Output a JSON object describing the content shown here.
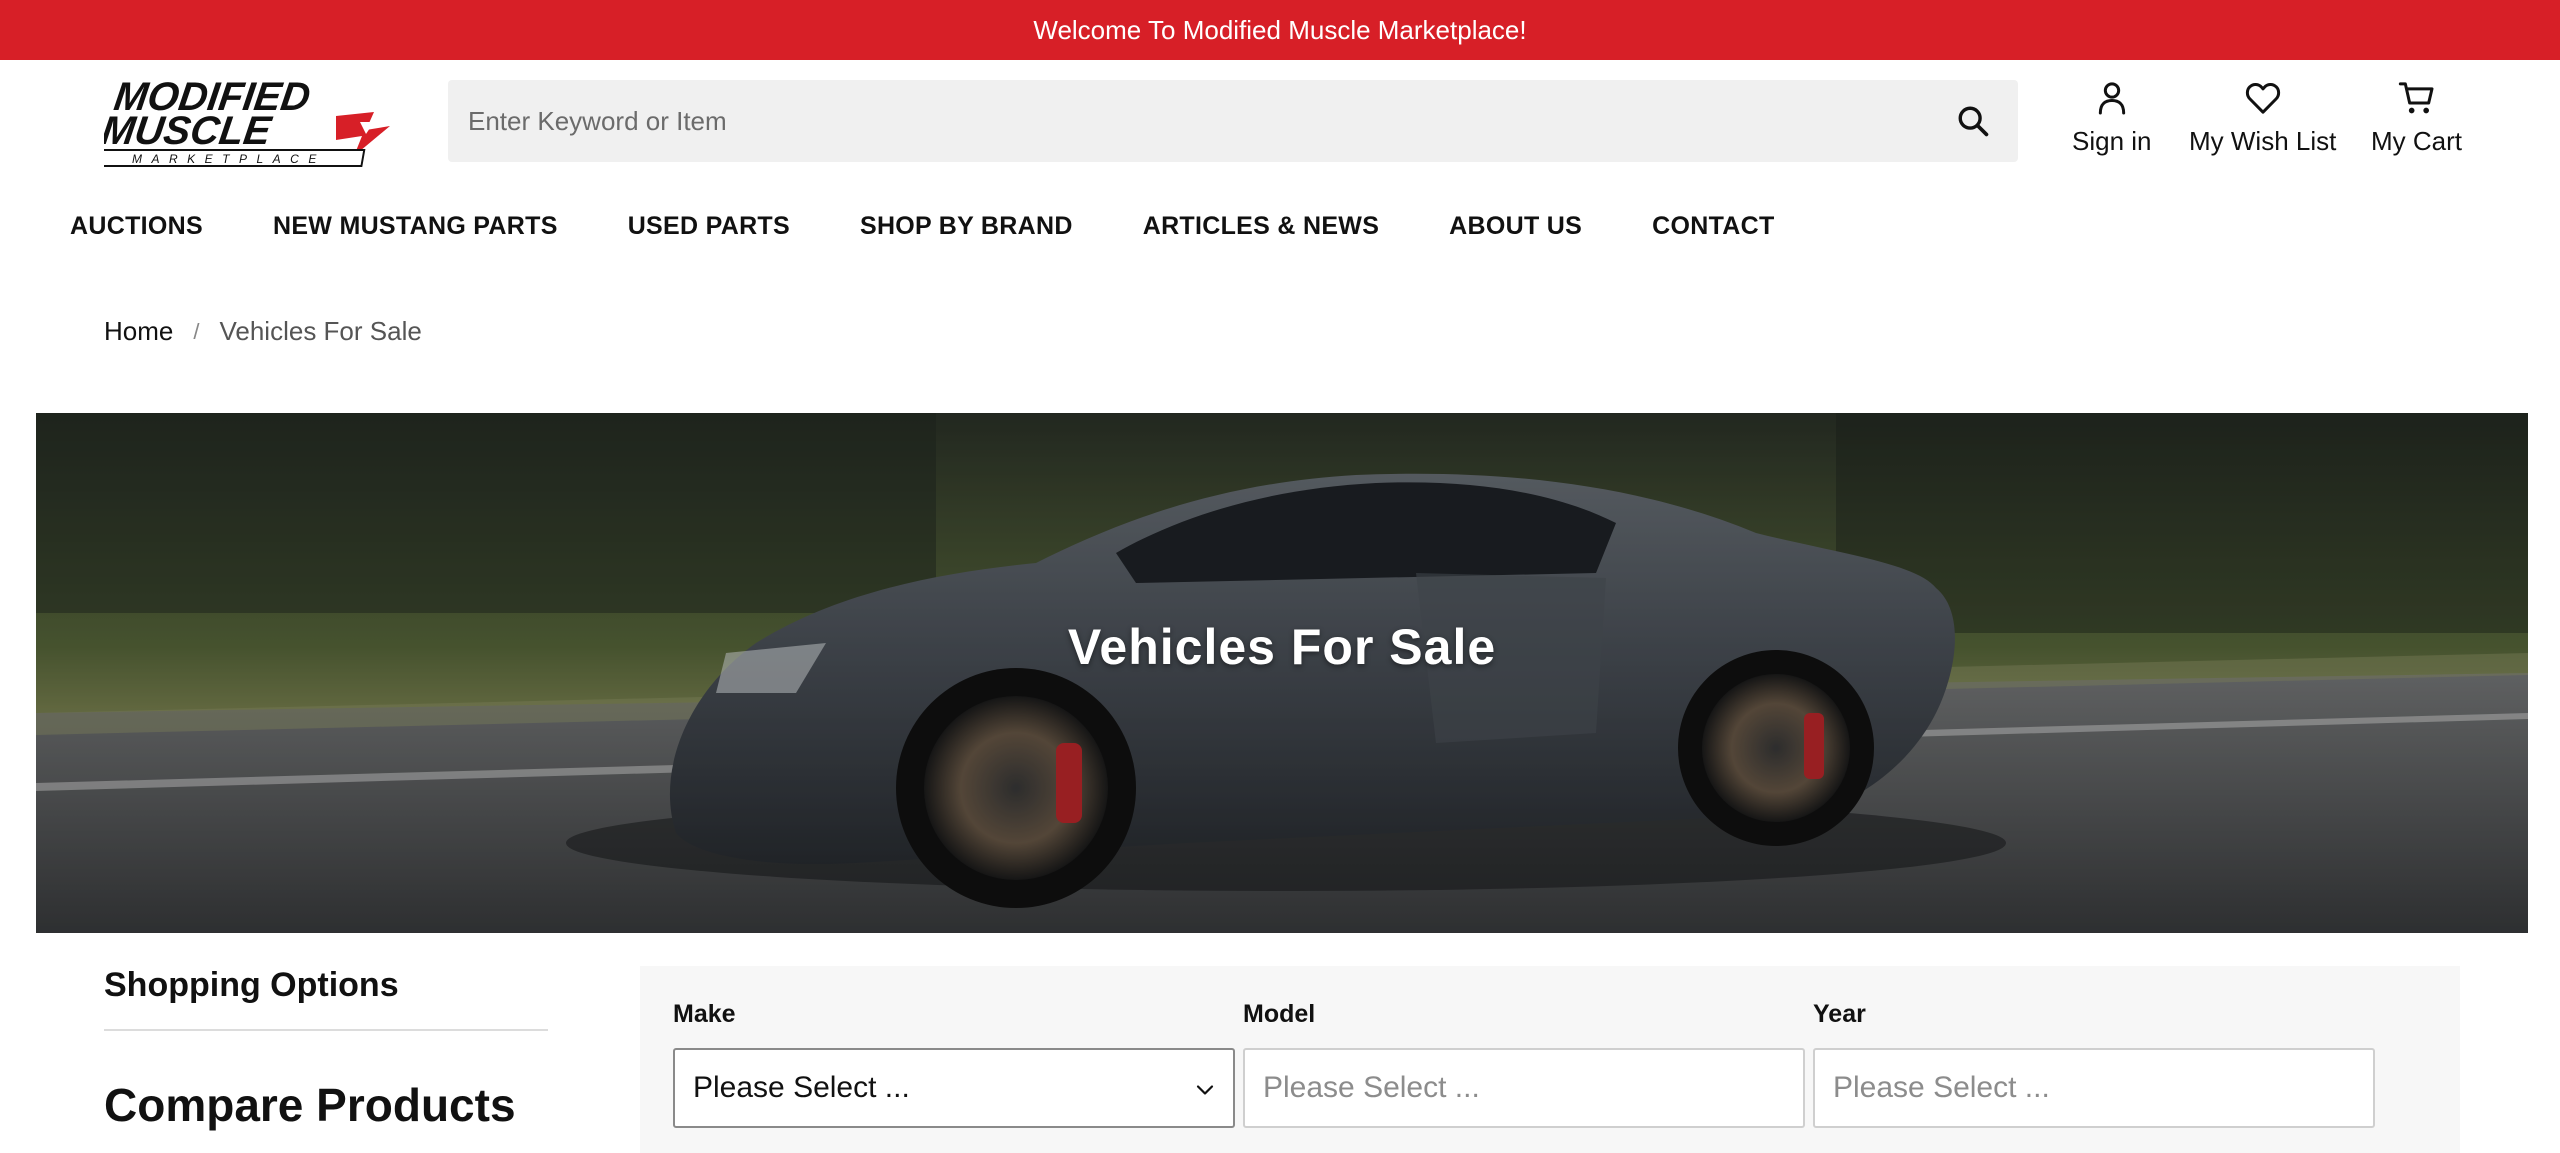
{
  "banner": {
    "text": "Welcome To Modified Muscle Marketplace!"
  },
  "brand": {
    "logo_line1": "MODIFIED",
    "logo_line2": "MUSCLE",
    "logo_line3": "MARKETPLACE",
    "colors": {
      "accent": "#d71f27",
      "text": "#111111"
    }
  },
  "search": {
    "placeholder": "Enter Keyword or Item",
    "value": "",
    "icon": "search-icon"
  },
  "account": {
    "sign_in": {
      "label": "Sign in",
      "icon": "user-icon"
    },
    "wish_list": {
      "label": "My Wish List",
      "icon": "heart-icon"
    },
    "cart": {
      "label": "My Cart",
      "icon": "cart-icon"
    }
  },
  "nav": {
    "items": [
      {
        "label": "AUCTIONS"
      },
      {
        "label": "NEW MUSTANG PARTS"
      },
      {
        "label": "USED PARTS"
      },
      {
        "label": "SHOP BY BRAND"
      },
      {
        "label": "ARTICLES & NEWS"
      },
      {
        "label": "ABOUT US"
      },
      {
        "label": "CONTACT"
      }
    ]
  },
  "breadcrumb": {
    "home": "Home",
    "separator": "/",
    "current": "Vehicles For Sale"
  },
  "hero": {
    "title": "Vehicles For Sale",
    "image": "gray-sports-car-photo"
  },
  "sidebar": {
    "shopping_options": "Shopping Options",
    "compare_products": "Compare Products"
  },
  "filters": {
    "make": {
      "label": "Make",
      "value": "Please Select ...",
      "enabled": true
    },
    "model": {
      "label": "Model",
      "value": "Please Select ...",
      "enabled": false
    },
    "year": {
      "label": "Year",
      "value": "Please Select ...",
      "enabled": false
    }
  }
}
